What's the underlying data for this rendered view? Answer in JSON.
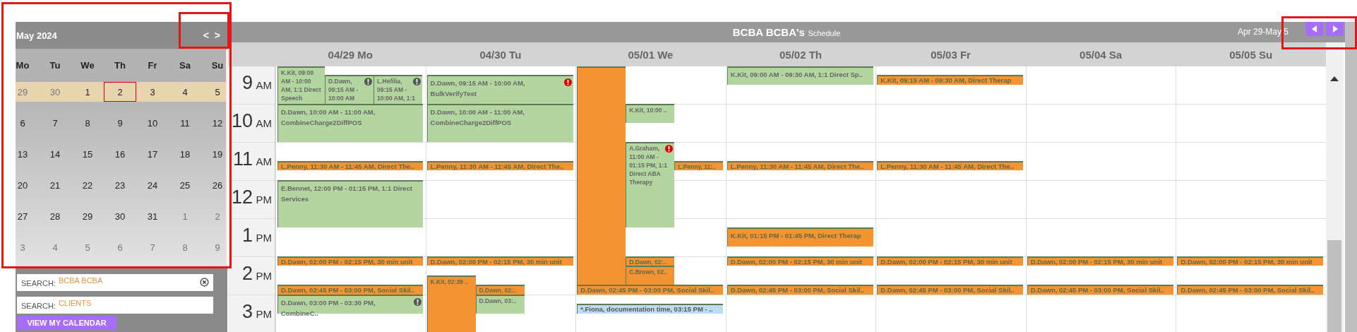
{
  "calendar": {
    "title": "May 2024",
    "nav": [
      "<",
      ">"
    ],
    "weekdays": [
      "Mo",
      "Tu",
      "We",
      "Th",
      "Fr",
      "Sa",
      "Su"
    ],
    "weeks": [
      {
        "current": true,
        "days": [
          {
            "label": "29",
            "muted": true,
            "selected": false
          },
          {
            "label": "30",
            "muted": true,
            "selected": false
          },
          {
            "label": "1",
            "muted": false,
            "selected": false
          },
          {
            "label": "2",
            "muted": false,
            "selected": true
          },
          {
            "label": "3",
            "muted": false,
            "selected": false
          },
          {
            "label": "4",
            "muted": false,
            "selected": false
          },
          {
            "label": "5",
            "muted": false,
            "selected": false
          }
        ]
      },
      {
        "current": false,
        "days": [
          {
            "label": "6",
            "muted": false,
            "selected": false
          },
          {
            "label": "7",
            "muted": false,
            "selected": false
          },
          {
            "label": "8",
            "muted": false,
            "selected": false
          },
          {
            "label": "9",
            "muted": false,
            "selected": false
          },
          {
            "label": "10",
            "muted": false,
            "selected": false
          },
          {
            "label": "11",
            "muted": false,
            "selected": false
          },
          {
            "label": "12",
            "muted": false,
            "selected": false
          }
        ]
      },
      {
        "current": false,
        "days": [
          {
            "label": "13",
            "muted": false,
            "selected": false
          },
          {
            "label": "14",
            "muted": false,
            "selected": false
          },
          {
            "label": "15",
            "muted": false,
            "selected": false
          },
          {
            "label": "16",
            "muted": false,
            "selected": false
          },
          {
            "label": "17",
            "muted": false,
            "selected": false
          },
          {
            "label": "18",
            "muted": false,
            "selected": false
          },
          {
            "label": "19",
            "muted": false,
            "selected": false
          }
        ]
      },
      {
        "current": false,
        "days": [
          {
            "label": "20",
            "muted": false,
            "selected": false
          },
          {
            "label": "21",
            "muted": false,
            "selected": false
          },
          {
            "label": "22",
            "muted": false,
            "selected": false
          },
          {
            "label": "23",
            "muted": false,
            "selected": false
          },
          {
            "label": "24",
            "muted": false,
            "selected": false
          },
          {
            "label": "25",
            "muted": false,
            "selected": false
          },
          {
            "label": "26",
            "muted": false,
            "selected": false
          }
        ]
      },
      {
        "current": false,
        "days": [
          {
            "label": "27",
            "muted": false,
            "selected": false
          },
          {
            "label": "28",
            "muted": false,
            "selected": false
          },
          {
            "label": "29",
            "muted": false,
            "selected": false
          },
          {
            "label": "30",
            "muted": false,
            "selected": false
          },
          {
            "label": "31",
            "muted": false,
            "selected": false
          },
          {
            "label": "1",
            "muted": true,
            "selected": false
          },
          {
            "label": "2",
            "muted": true,
            "selected": false
          }
        ]
      },
      {
        "current": false,
        "days": [
          {
            "label": "3",
            "muted": true,
            "selected": false
          },
          {
            "label": "4",
            "muted": true,
            "selected": false
          },
          {
            "label": "5",
            "muted": true,
            "selected": false
          },
          {
            "label": "6",
            "muted": true,
            "selected": false
          },
          {
            "label": "7",
            "muted": true,
            "selected": false
          },
          {
            "label": "8",
            "muted": true,
            "selected": false
          },
          {
            "label": "9",
            "muted": true,
            "selected": false
          }
        ]
      }
    ]
  },
  "search_fields": [
    {
      "label": "SEARCH:",
      "value": "BCBA BCBA",
      "clearable": true
    },
    {
      "label": "SEARCH:",
      "placeholder": "CLIENTS",
      "clearable": false
    }
  ],
  "view_button": "VIEW MY CALENDAR",
  "schedule": {
    "title": "BCBA BCBA's",
    "subtitle": "Schedule",
    "range": "Apr 29-May 5",
    "hours": [
      {
        "hour": "9",
        "period": "AM"
      },
      {
        "hour": "10",
        "period": "AM"
      },
      {
        "hour": "11",
        "period": "AM"
      },
      {
        "hour": "12",
        "period": "PM"
      },
      {
        "hour": "1",
        "period": "PM"
      },
      {
        "hour": "2",
        "period": "PM"
      },
      {
        "hour": "3",
        "period": "PM"
      }
    ],
    "days": [
      {
        "label": "04/29 Mo",
        "events": [
          {
            "kind": "session",
            "text": "K.Kit, 09:00 AM - 10:00 AM, 1:1 Direct Speech"
          },
          {
            "kind": "session",
            "text": "D.Dawn, 09:15 AM - 10:00 AM",
            "alert": {
              "kind": "warning"
            }
          },
          {
            "kind": "session",
            "text": "L.Hefilia, 09:15 AM - 10:00 AM, 1:1",
            "alert": {
              "kind": "warning"
            }
          },
          {
            "kind": "session",
            "text": "D.Dawn, 10:00 AM - 11:00 AM, CombineCharge2DiffPOS"
          },
          {
            "kind": "unit",
            "text": "L.Penny, 11:30 AM - 11:45 AM, Direct The.."
          },
          {
            "kind": "session",
            "text": "E.Bennet, 12:00 PM - 01:15 PM, 1:1 Direct Services"
          },
          {
            "kind": "unit",
            "text": "D.Dawn, 02:00 PM - 02:15 PM, 30 min unit"
          },
          {
            "kind": "unit",
            "text": "D.Dawn, 02:45 PM - 03:00 PM, Social Skil.."
          },
          {
            "kind": "session",
            "text": "D.Dawn, 03:00 PM - 03:30 PM, CombineC..",
            "alert": {
              "kind": "warning"
            }
          }
        ]
      },
      {
        "label": "04/30 Tu",
        "events": [
          {
            "kind": "session",
            "text": "D.Dawn, 09:15 AM - 10:00 AM, BulkVerifyTest",
            "alert": {
              "kind": "error"
            }
          },
          {
            "kind": "session",
            "text": "D.Dawn, 10:00 AM - 11:00 AM, CombineCharge2DiffPOS"
          },
          {
            "kind": "unit",
            "text": "L.Penny, 11:30 AM - 11:45 AM, Direct The.."
          },
          {
            "kind": "unit",
            "text": "D.Dawn, 02:00 PM - 02:15 PM, 30 min unit"
          },
          {
            "kind": "unit",
            "text": "K.Kit, 02:39 .."
          },
          {
            "kind": "unit",
            "text": "D.Dawn, 02:.."
          },
          {
            "kind": "session",
            "text": "D.Dawn, 03:.."
          }
        ]
      },
      {
        "label": "05/01 We",
        "events": [
          {
            "kind": "unit"
          },
          {
            "kind": "session",
            "text": "K.Kit, 10:00 .."
          },
          {
            "kind": "session",
            "text": "A.Graham, 11:00 AM - 01:15 PM, 1:1 Direct ABA Therapy",
            "alert": {
              "kind": "error"
            }
          },
          {
            "kind": "unit",
            "text": "L.Penny, 11:.."
          },
          {
            "kind": "unit",
            "text": "D.Dawn, 02:.."
          },
          {
            "kind": "unit",
            "text": "C.Brown, 02.."
          },
          {
            "kind": "unit",
            "text": "D.Dawn, 02:45 PM - 03:00 PM, Social Skil.."
          },
          {
            "kind": "note",
            "text": "*.Fiona, documentation time, 03:15 PM - .."
          }
        ]
      },
      {
        "label": "05/02 Th",
        "events": [
          {
            "kind": "session",
            "text": "K.Kit, 09:00 AM - 09:30 AM, 1:1 Direct Sp.."
          },
          {
            "kind": "unit",
            "text": "L.Penny, 11:30 AM - 11:45 AM, Direct The.."
          },
          {
            "kind": "unit",
            "text": "K.Kit, 01:15 PM - 01:45 PM, Direct Therap"
          },
          {
            "kind": "unit",
            "text": "D.Dawn, 02:00 PM - 02:15 PM, 30 min unit"
          },
          {
            "kind": "unit",
            "text": "D.Dawn, 02:45 PM - 03:00 PM, Social Skil.."
          }
        ]
      },
      {
        "label": "05/03 Fr",
        "events": [
          {
            "kind": "unit",
            "text": "K.Kit, 09:15 AM - 09:30 AM, Direct Therap"
          },
          {
            "kind": "unit",
            "text": "L.Penny, 11:30 AM - 11:45 AM, Direct The.."
          },
          {
            "kind": "unit",
            "text": "D.Dawn, 02:00 PM - 02:15 PM, 30 min unit"
          },
          {
            "kind": "unit",
            "text": "D.Dawn, 02:45 PM - 03:00 PM, Social Skil.."
          }
        ]
      },
      {
        "label": "05/04 Sa",
        "events": [
          {
            "kind": "unit",
            "text": "D.Dawn, 02:00 PM - 02:15 PM, 30 min unit"
          },
          {
            "kind": "unit",
            "text": "D.Dawn, 02:45 PM - 03:00 PM, Social Skil.."
          }
        ]
      },
      {
        "label": "05/05 Su",
        "events": [
          {
            "kind": "unit",
            "text": "D.Dawn, 02:00 PM - 02:15 PM, 30 min unit"
          },
          {
            "kind": "unit",
            "text": "D.Dawn, 02:45 PM - 03:00 PM, Social Skil.."
          }
        ]
      }
    ]
  }
}
